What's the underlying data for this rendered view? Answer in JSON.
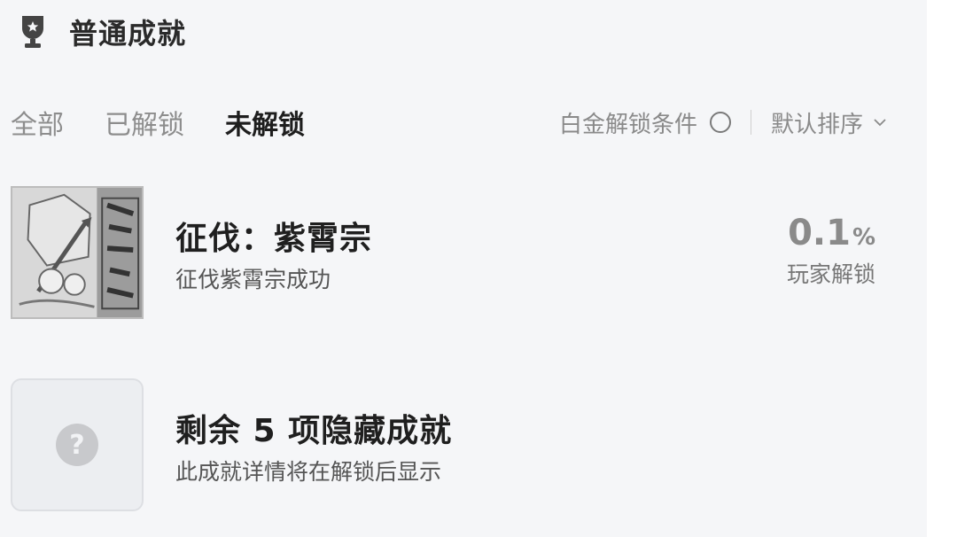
{
  "header": {
    "icon": "trophy-icon",
    "title": "普通成就"
  },
  "tabs": [
    {
      "label": "全部",
      "active": false
    },
    {
      "label": "已解锁",
      "active": false
    },
    {
      "label": "未解锁",
      "active": true
    }
  ],
  "tools": {
    "platinum_label": "白金解锁条件",
    "platinum_checked": false,
    "sort_label": "默认排序",
    "sort_icon": "chevron-down-icon"
  },
  "achievements": [
    {
      "title": "征伐：紫霄宗",
      "description": "征伐紫霄宗成功",
      "percent": "0.1",
      "percent_unit": "%",
      "percent_label": "玩家解锁",
      "icon": "achievement-artwork"
    }
  ],
  "hidden": {
    "title": "剩余 5 项隐藏成就",
    "description": "此成就详情将在解锁后显示",
    "icon_text": "?"
  },
  "colors": {
    "background": "#f5f6f8",
    "active_tab": "#1e1e1e",
    "inactive_tab": "#8d8d8d",
    "stat": "#8a8a8a"
  }
}
